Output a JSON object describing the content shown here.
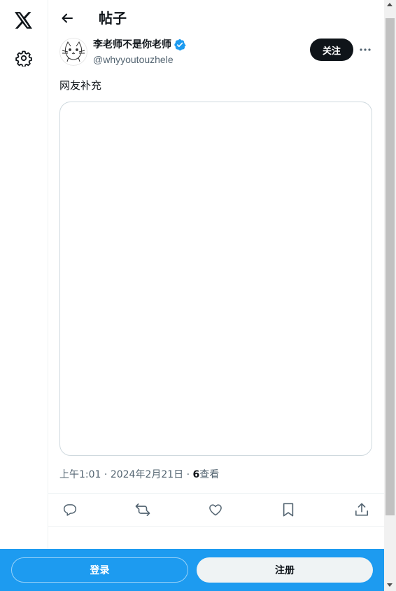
{
  "header": {
    "title": "帖子"
  },
  "author": {
    "name": "李老师不是你老师",
    "handle": "@whyyoutouzhele",
    "follow_label": "关注"
  },
  "post": {
    "text": "网友补充",
    "time": "上午1:01",
    "date": "2024年2月21日",
    "separator": "·",
    "views_count": "6",
    "views_label": "查看"
  },
  "actions": {
    "reply_icon": "reply-icon",
    "repost_icon": "repost-icon",
    "like_icon": "like-icon",
    "bookmark_icon": "bookmark-icon",
    "share_icon": "share-icon"
  },
  "bottom_bar": {
    "login_label": "登录",
    "signup_label": "注册"
  },
  "colors": {
    "accent": "#1d9bf0",
    "text": "#0f1419",
    "muted": "#536471",
    "border": "#eff3f4"
  }
}
